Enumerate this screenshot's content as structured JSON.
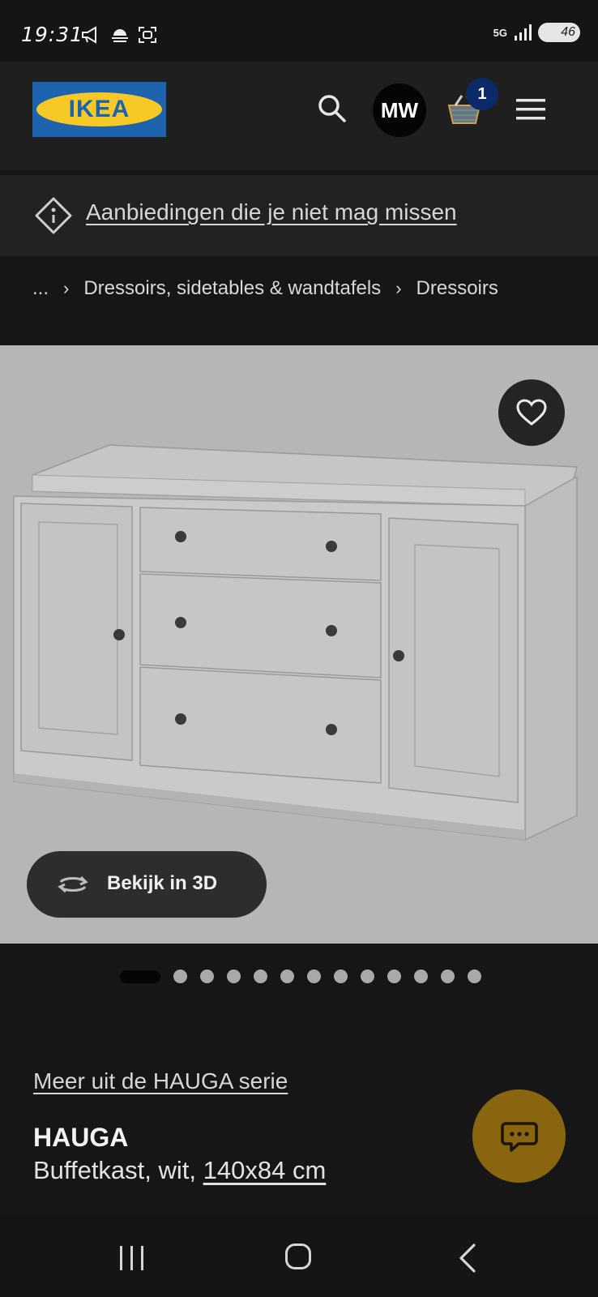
{
  "status": {
    "time": "19:31",
    "network": "5G",
    "battery": "46"
  },
  "header": {
    "logo_text": "IKEA",
    "avatar_initials": "MW",
    "cart_count": "1"
  },
  "promo": {
    "label": "Aanbiedingen die je niet mag missen"
  },
  "breadcrumb": {
    "items": [
      "...",
      "Dressoirs, sidetables & wandtafels",
      "Dressoirs"
    ]
  },
  "gallery": {
    "view3d_label": "Bekijk in 3D",
    "total_images": 13,
    "active_index": 0
  },
  "product": {
    "series_link": "Meer uit de HAUGA serie",
    "name": "HAUGA",
    "description_prefix": "Buffetkast, wit,",
    "size": "140x84 cm"
  },
  "colors": {
    "background": "#161616",
    "ikea_blue": "#1d63ad",
    "ikea_yellow": "#f7c926",
    "image_bg": "#b6b6b6",
    "chat_button": "#8a6510",
    "badge": "#0c2a68"
  },
  "icons": {
    "search": "search-icon",
    "cart": "basket-icon",
    "menu": "hamburger-menu-icon",
    "favorite": "heart-icon",
    "promo": "tag-icon",
    "view3d": "rotate-3d-icon",
    "chat": "chat-icon"
  }
}
